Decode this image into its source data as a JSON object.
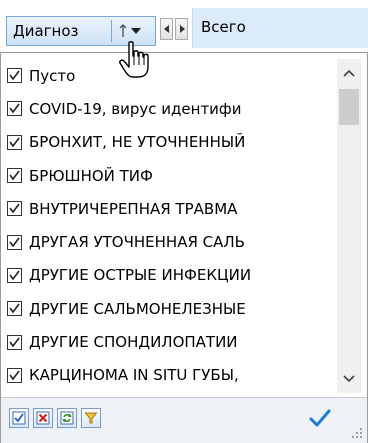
{
  "header": {
    "field_label": "Диагноз",
    "total_label": "Всего"
  },
  "list": {
    "items": [
      {
        "label": "Пусто",
        "checked": true
      },
      {
        "label": "COVID-19, вирус идентифи",
        "checked": true
      },
      {
        "label": "БРОНХИТ, НЕ УТОЧНЕННЫЙ",
        "checked": true
      },
      {
        "label": "БРЮШНОЙ ТИФ",
        "checked": true
      },
      {
        "label": "ВНУТРИЧЕРЕПНАЯ ТРАВМА",
        "checked": true
      },
      {
        "label": "ДРУГАЯ УТОЧНЕННАЯ САЛЬ",
        "checked": true
      },
      {
        "label": "ДРУГИЕ ОСТРЫЕ ИНФЕКЦИИ",
        "checked": true
      },
      {
        "label": "ДРУГИЕ САЛЬМОНЕЛЕЗНЫЕ",
        "checked": true
      },
      {
        "label": "ДРУГИЕ СПОНДИЛОПАТИИ",
        "checked": true
      },
      {
        "label": "КАРЦИНОМА IN SITU ГУБЫ,",
        "checked": true
      }
    ]
  },
  "footer": {
    "buttons": [
      "check-all-icon",
      "uncheck-all-icon",
      "invert-selection-icon",
      "filter-icon"
    ],
    "ok_icon": "checkmark-icon"
  },
  "colors": {
    "chip_border": "#7aa7d6",
    "total_bg": "#dcebfa",
    "checkmark": "#1f7ad6"
  }
}
